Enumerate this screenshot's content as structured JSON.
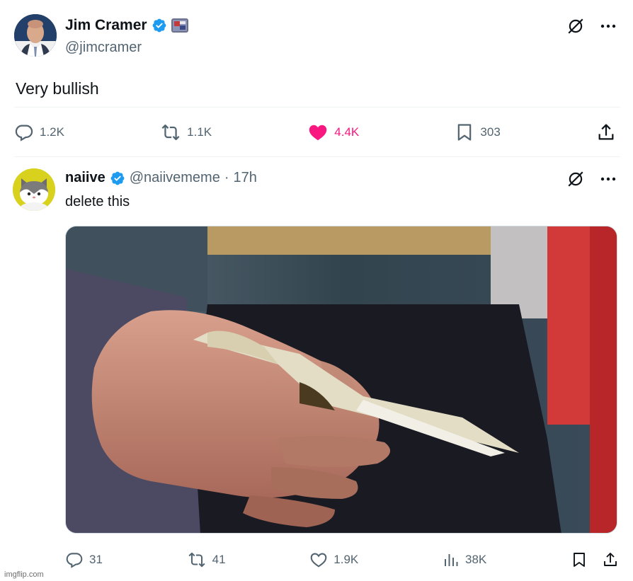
{
  "main_tweet": {
    "author": {
      "display_name": "Jim Cramer",
      "handle": "@jimcramer"
    },
    "text": "Very bullish",
    "metrics": {
      "replies": "1.2K",
      "retweets": "1.1K",
      "likes": "4.4K",
      "bookmarks": "303"
    },
    "liked": true
  },
  "reply": {
    "author": {
      "display_name": "naiive",
      "handle": "@naiivememe",
      "separator": "·",
      "timestamp": "17h"
    },
    "text": "delete this",
    "metrics": {
      "replies": "31",
      "retweets": "41",
      "likes": "1.9K",
      "views": "38K"
    }
  },
  "colors": {
    "like_pink": "#f91880",
    "verified_blue": "#1d9bf0",
    "muted": "#536471"
  },
  "watermark": "imgflip.com"
}
